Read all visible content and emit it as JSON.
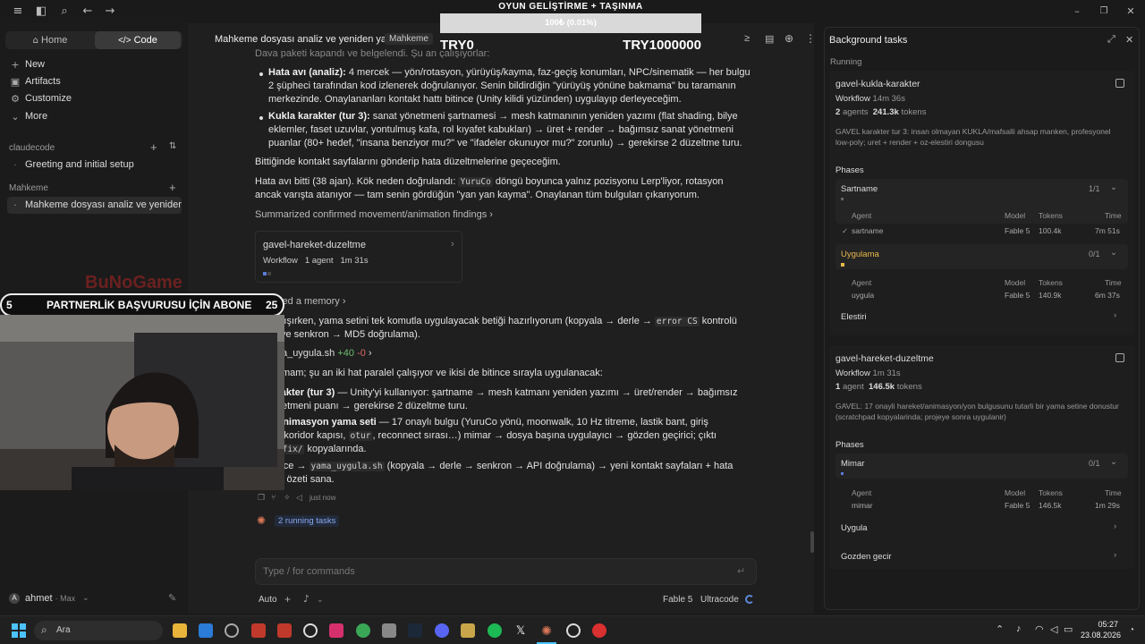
{
  "app": {
    "chat_title": "Mahkeme dosyası analiz ve yeniden yazım",
    "chat_badge": "Mahkeme"
  },
  "sidebar": {
    "seg_home": "Home",
    "seg_code": "Code",
    "items": [
      {
        "icon": "+",
        "label": "New"
      },
      {
        "icon": "▣",
        "label": "Artifacts"
      },
      {
        "icon": "⚙",
        "label": "Customize"
      },
      {
        "icon": "⌄",
        "label": "More"
      }
    ],
    "section1": "claudecode",
    "section1_items": [
      "Greeting and initial setup"
    ],
    "section2": "Mahkeme",
    "section2_items": [
      "Mahkeme dosyası analiz ve yeniden yazım"
    ],
    "user": {
      "initial": "A",
      "name": "ahmet",
      "plan": "· Max"
    }
  },
  "overlay": {
    "title": "OYUN GELİŞTİRME + TAŞINMA",
    "progress_label": "100₺ (0.01%)",
    "progress_fraction": 0.0001,
    "min": "TRY0",
    "max": "TRY1000000",
    "banner": "PARTNERLİK BAŞVURUSU İÇİN ABONE",
    "banner_left": "5",
    "banner_right": "25",
    "logo": "BuNoGame"
  },
  "chat": {
    "partial_top": "Dava paketi kapandı ve belgelendi. Şu an çalışıyorlar:",
    "b1_bold": "Hata avı (analiz):",
    "b1_text": " 4 mercek — yön/rotasyon, yürüyüş/kayma, faz-geçiş konumları, NPC/sinematik — her bulgu 2 şüpheci tarafından kod izlenerek doğrulanıyor. Senin bildirdiğin \"yürüyüş yönüne bakmama\" bu taramanın merkezinde. Onaylananları kontakt hattı bitince (Unity kilidi yüzünden) uygulayıp derleyeceğim.",
    "b2_bold": "Kukla karakter (tur 3):",
    "b2_text": " sanat yönetmeni şartnamesi → mesh katmanının yeniden yazımı (flat shading, bilye eklemler, faset uzuvlar, yontulmuş kafa, rol kıyafet kabukları) → üret + render → bağımsız sanat yönetmeni puanlar (80+ hedef, \"insana benziyor mu?\" ve \"ifadeler okunuyor mu?\" zorunlu) → gerekirse 2 düzeltme turu.",
    "p1": "Bittiğinde kontakt sayfalarını gönderip hata düzeltmelerine geçeceğim.",
    "p2a": "Hata avı bitti (38 ajan). Kök neden doğrulandı: ",
    "p2_code": "YuruCo",
    "p2b": " döngü boyunca yalnız pozisyonu Lerp'liyor, rotasyon ancak varışta atanıyor — tam senin gördüğün \"yan yan kayma\". Onaylanan tüm bulguları çıkarıyorum.",
    "summary_link": "Summarized confirmed movement/animation findings",
    "wf_title": "gavel-hareket-duzeltme",
    "wf_kind": "Workflow",
    "wf_agents": "1 agent",
    "wf_time": "1m 31s",
    "memory_link": "Recalled a memory",
    "p3a": "hat çalışırken, yama setini tek komutla uygulayacak betiği hazırlıyorum (kopyala → derle → ",
    "p3_code1": "error CS",
    "p3b": " kontrolü",
    "p3_code2": "keme",
    "p3c": "'ye senkron → MD5 doğrulama).",
    "file_line": "d yama_uygula.sh",
    "file_add": "+40",
    "file_del": "-0",
    "p4": "klar tamam; şu an iki hat paralel çalışıyor ve ikisi de bitince sırayla uygulanacak:",
    "b3_bold": "la karakter (tur 3)",
    "b3_text": " — Unity'yi kullanıyor: şartname → mesh katmanı yeniden yazımı → üret/render → bağımsız",
    "b3_text2": "at yönetmeni puanı → gerekirse 2 düzeltme turu.",
    "b4_bold": "eket/animasyon yama seti",
    "b4_text": " — 17 onaylı bulgu (YuruCo yönü, moonwalk, 10 Hz titreme, lastik bant, giriş",
    "b4_text2a": "matik, koridor kapısı, ",
    "b4_code": "otur",
    "b4_text2b": ", reconnect sırası…) mimar → dosya başına uygulayıcı → gözden geçirici; çıktı",
    "b4_code2": "eket_fix/",
    "b4_text3": " kopyalarında.",
    "p5a": "la bitince → ",
    "p5_code": "yama_uygula.sh",
    "p5b": " (kopyala → derle → senkron → API doğrulama) → yeni kontakt sayfaları + hata",
    "p5c": "zeltme özeti sana.",
    "timestamp": "just now",
    "running_tasks": "2 running tasks",
    "input_placeholder": "Type / for commands",
    "mode": "Auto",
    "model": "Fable 5",
    "effort": "Ultracode"
  },
  "background": {
    "title": "Background tasks",
    "running": "Running",
    "tasks": [
      {
        "name": "gavel-kukla-karakter",
        "kind": "Workflow",
        "time": "14m 36s",
        "agents": "2",
        "agents_label": "agents",
        "tokens": "241.3k",
        "tokens_label": "tokens",
        "desc": "GAVEL karakter tur 3: insan olmayan KUKLA/mafsalli ahsap manken, profesyonel low-poly; uret + render + oz-elestiri dongusu",
        "phases_label": "Phases",
        "phases": [
          {
            "name": "Sartname",
            "count": "1/1",
            "agent": "sartname",
            "model": "Fable 5",
            "tokens": "100.4k",
            "time": "7m 51s"
          },
          {
            "name": "Uygulama",
            "count": "0/1",
            "agent": "uygula",
            "model": "Fable 5",
            "tokens": "140.9k",
            "time": "6m 37s"
          },
          {
            "name": "Elestiri"
          }
        ]
      },
      {
        "name": "gavel-hareket-duzeltme",
        "kind": "Workflow",
        "time": "1m 31s",
        "agents": "1",
        "agents_label": "agent",
        "tokens": "146.5k",
        "tokens_label": "tokens",
        "desc": "GAVEL: 17 onayli hareket/animasyon/yon bulgusunu tutarli bir yama setine donustur (scratchpad kopyalarinda; projeye sonra uygulanir)",
        "phases_label": "Phases",
        "phases": [
          {
            "name": "Mimar",
            "count": "0/1",
            "agent": "mimar",
            "model": "Fable 5",
            "tokens": "146.5k",
            "time": "1m 29s"
          },
          {
            "name": "Uygula"
          },
          {
            "name": "Gozden gecir"
          }
        ]
      }
    ],
    "col_agent": "Agent",
    "col_model": "Model",
    "col_tokens": "Tokens",
    "col_time": "Time"
  },
  "taskbar": {
    "search": "Ara",
    "time": "05:27",
    "date": "23.08.2026"
  }
}
